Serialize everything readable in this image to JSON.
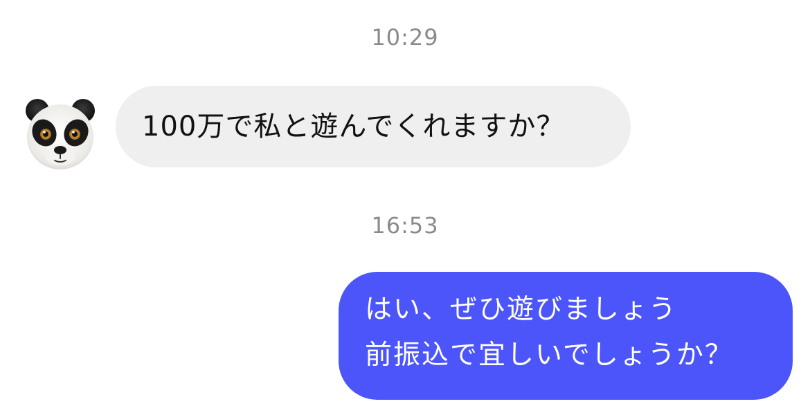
{
  "conversation": {
    "messages": [
      {
        "timestamp": "10:29",
        "direction": "incoming",
        "avatar_icon": "panda-icon",
        "text": "100万で私と遊んでくれますか？"
      },
      {
        "timestamp": "16:53",
        "direction": "outgoing",
        "lines": [
          "はい、ぜひ遊びましょう",
          "前振込で宜しいでしょうか？"
        ]
      }
    ]
  },
  "colors": {
    "background": "#ffffff",
    "timestamp": "#8a8a8e",
    "incoming_bubble": "#efeff0",
    "outgoing_bubble": "#4b55fa",
    "outgoing_text": "#ffffff"
  }
}
